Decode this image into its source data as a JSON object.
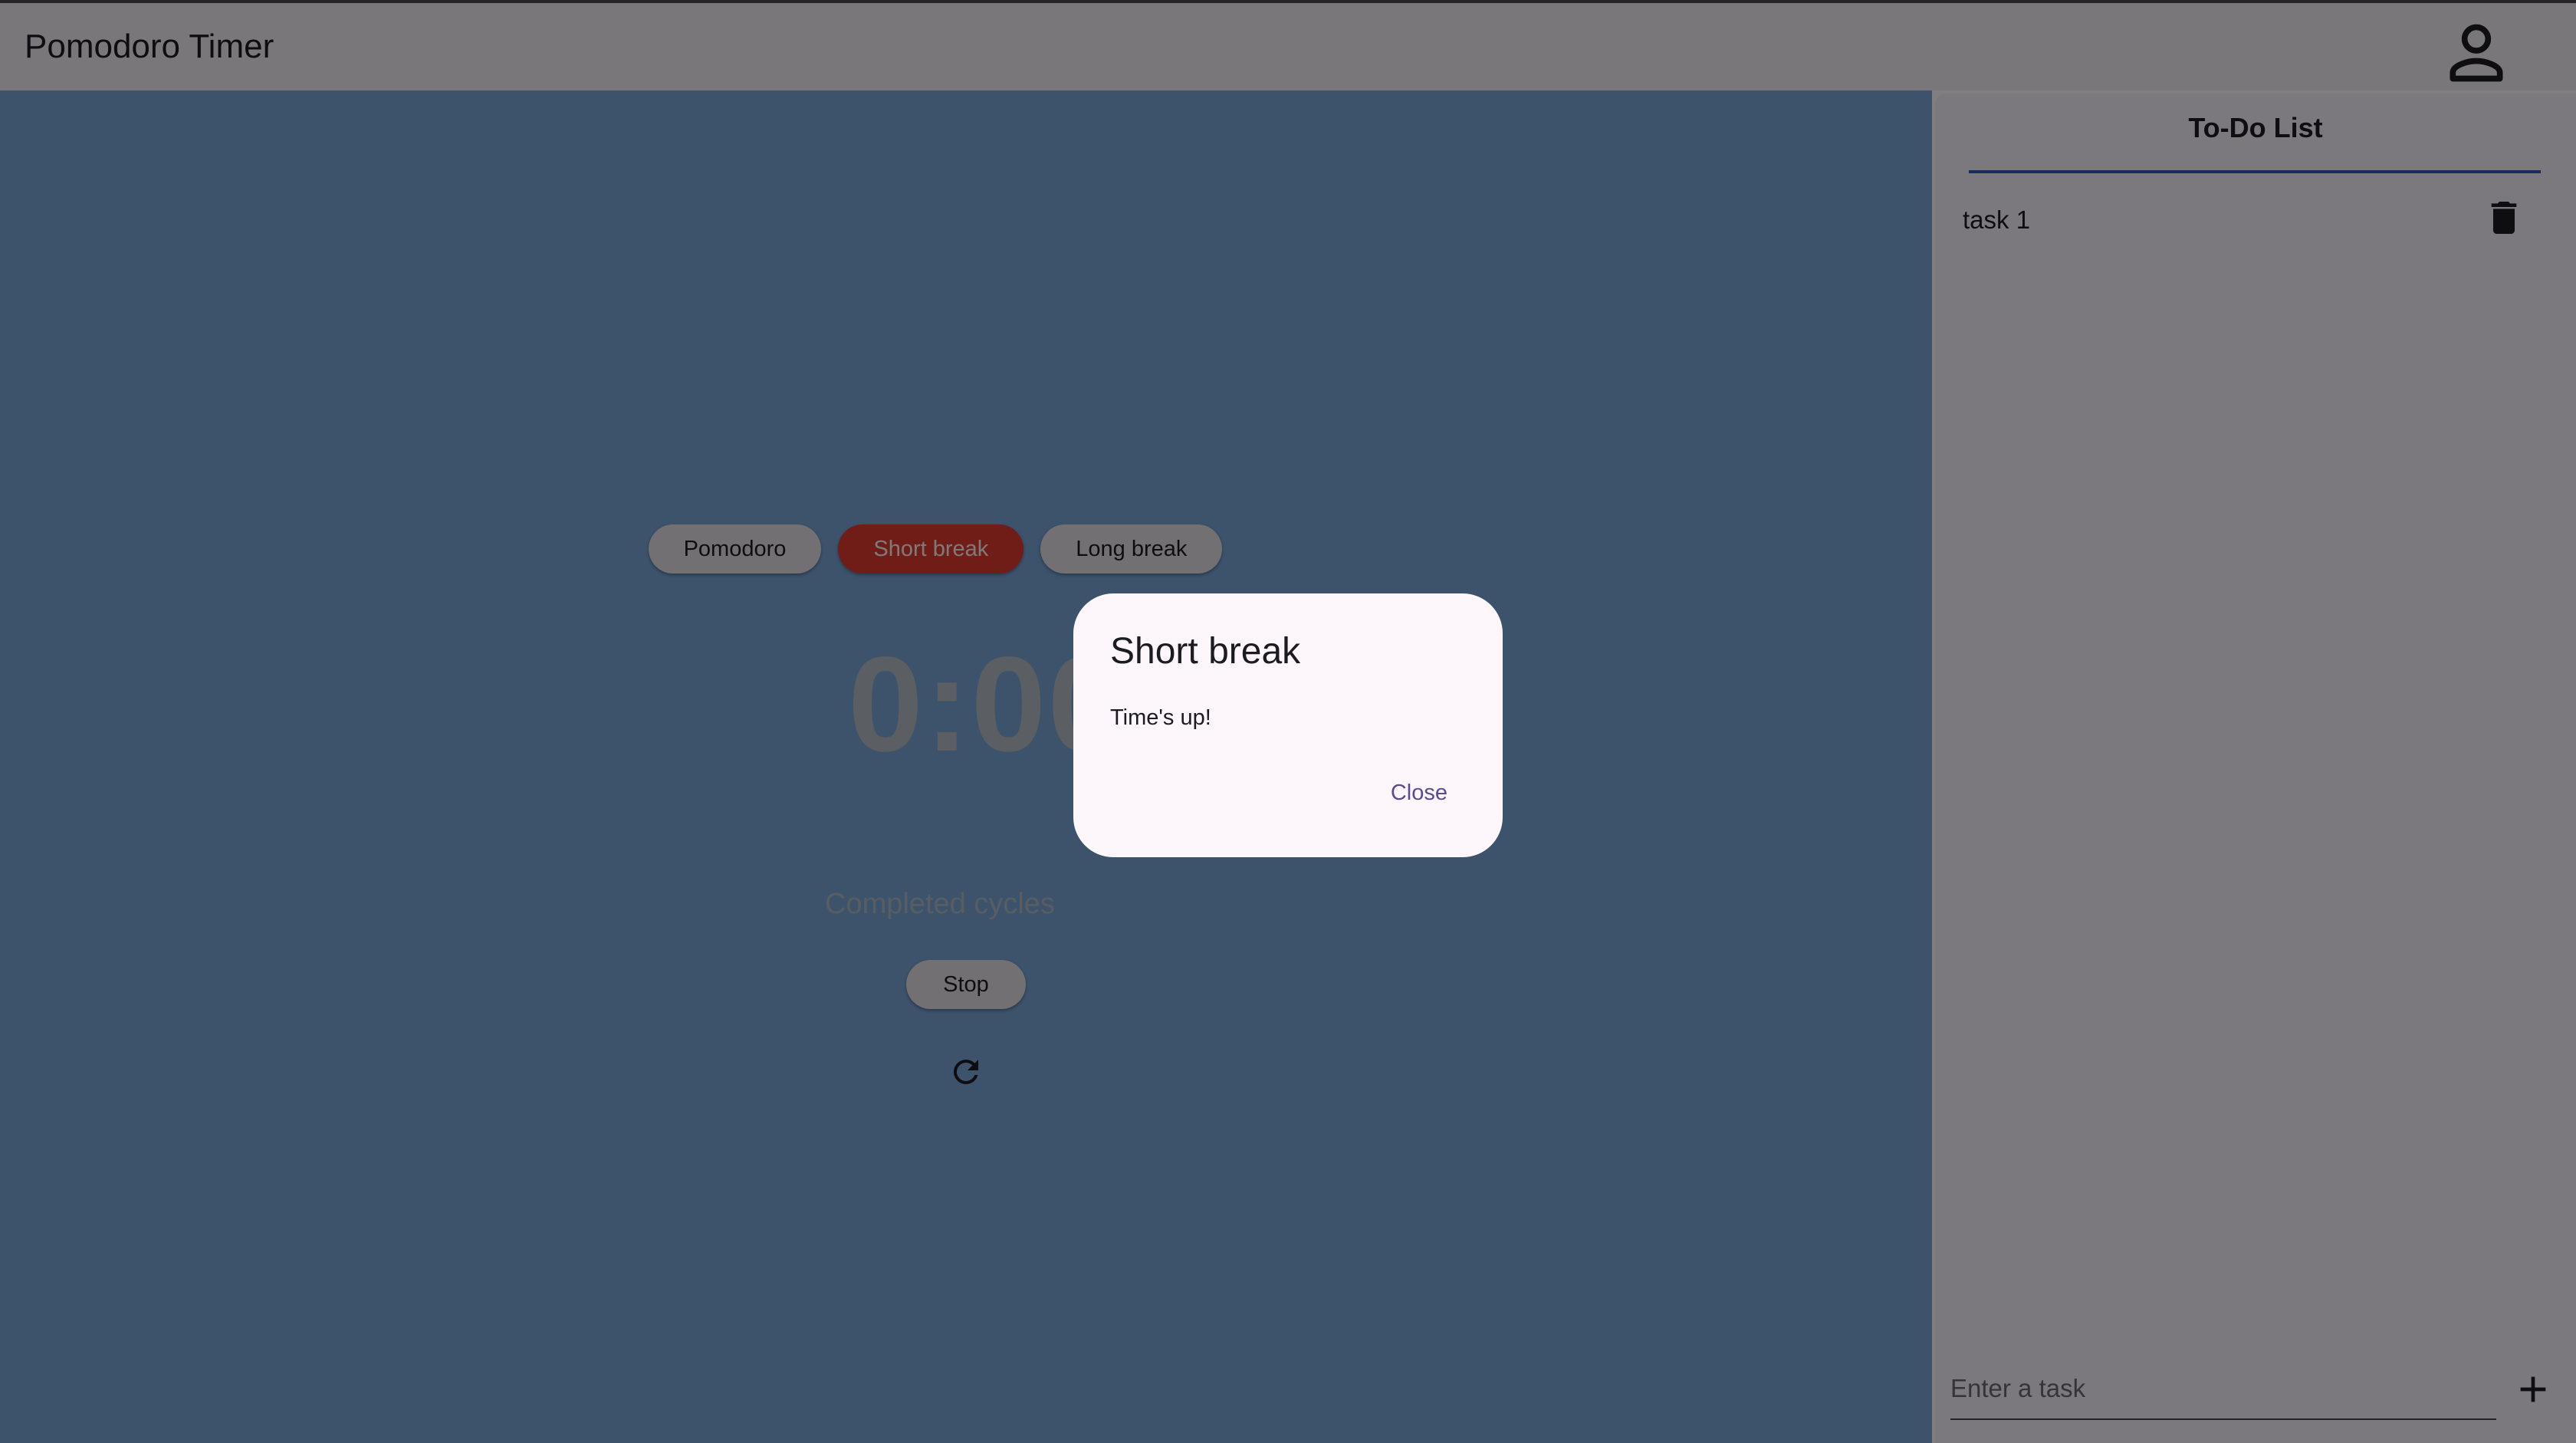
{
  "appbar": {
    "title": "Pomodoro Timer",
    "account_icon": "account-circle-outline-icon"
  },
  "timer": {
    "modes": [
      "Pomodoro",
      "Short break",
      "Long break"
    ],
    "active_mode": "Short break",
    "display": "0:00",
    "cycles_label": "Completed cycles",
    "stop_label": "Stop",
    "reset_icon": "refresh-icon"
  },
  "todo": {
    "title": "To-Do List",
    "tasks": [
      {
        "label": "task 1",
        "delete_icon": "trash-icon"
      }
    ],
    "input_placeholder": "Enter a task",
    "add_icon": "plus-icon"
  },
  "dialog": {
    "title": "Short break",
    "message": "Time's up!",
    "close_label": "Close"
  },
  "colors": {
    "accent": "#3456b8",
    "active_mode": "#e13a2f",
    "background": "#7aa7d8",
    "dialog_action": "#5b4a91"
  }
}
